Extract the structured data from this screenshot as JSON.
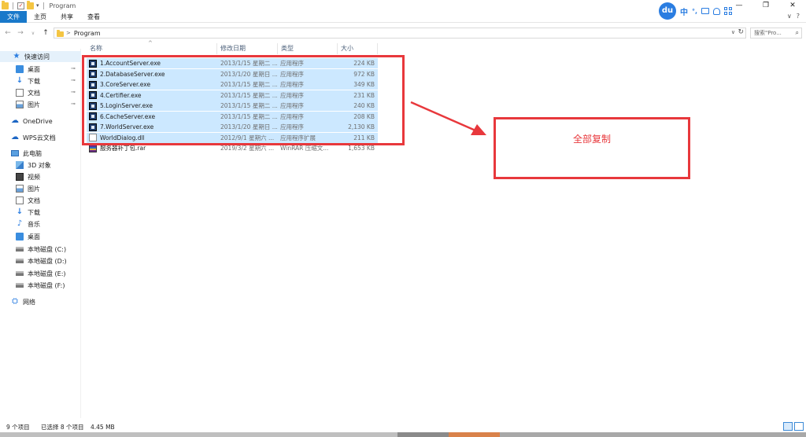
{
  "window": {
    "title": "Program",
    "minimize": "—",
    "restore": "❐",
    "close": "✕"
  },
  "ribbon": {
    "tabs": [
      {
        "label": "文件",
        "active": true
      },
      {
        "label": "主页",
        "active": false
      },
      {
        "label": "共享",
        "active": false
      },
      {
        "label": "查看",
        "active": false
      }
    ],
    "collapse_glyph": "∨",
    "help_glyph": "?"
  },
  "ime": {
    "logo": "du",
    "mode": "中",
    "punct": "°,"
  },
  "address": {
    "path": "Program",
    "back": "←",
    "forward": "→",
    "recent": "∨",
    "up": "↑",
    "crumb_sep": ">",
    "dropdown": "∨",
    "refresh": "↻",
    "search_placeholder": "搜索\"Pro...",
    "search_glyph": "⌕"
  },
  "sidebar": {
    "quick_access": {
      "label": "快速访问",
      "glyph": "★"
    },
    "pinned": [
      {
        "label": "桌面",
        "icon": "desktop-icon"
      },
      {
        "label": "下载",
        "icon": "download-icon",
        "glyph": "↓"
      },
      {
        "label": "文档",
        "icon": "document-icon"
      },
      {
        "label": "图片",
        "icon": "picture-icon"
      }
    ],
    "pin_glyph": "📌",
    "onedrive": {
      "label": "OneDrive",
      "glyph": "☁"
    },
    "wps": {
      "label": "WPS云文档",
      "glyph": "☁"
    },
    "this_pc": {
      "label": "此电脑"
    },
    "pc_items": [
      {
        "label": "3D 对象",
        "icon": "3d-objects-icon"
      },
      {
        "label": "视频",
        "icon": "video-icon"
      },
      {
        "label": "图片",
        "icon": "picture-icon"
      },
      {
        "label": "文档",
        "icon": "document-icon"
      },
      {
        "label": "下载",
        "icon": "download-icon",
        "glyph": "↓"
      },
      {
        "label": "音乐",
        "icon": "music-icon",
        "glyph": "♪"
      },
      {
        "label": "桌面",
        "icon": "desktop-icon"
      },
      {
        "label": "本地磁盘 (C:)",
        "icon": "drive-icon"
      },
      {
        "label": "本地磁盘 (D:)",
        "icon": "drive-icon"
      },
      {
        "label": "本地磁盘 (E:)",
        "icon": "drive-icon"
      },
      {
        "label": "本地磁盘 (F:)",
        "icon": "drive-icon"
      }
    ],
    "network": {
      "label": "网络",
      "glyph": "⛭"
    }
  },
  "columns": {
    "name": "名称",
    "date": "修改日期",
    "type": "类型",
    "size": "大小",
    "sort_glyph": "^"
  },
  "files": [
    {
      "name": "1.AccountServer.exe",
      "date": "2013/1/15 星期二 ...",
      "type": "应用程序",
      "size": "224 KB",
      "kind": "exe",
      "selected": true
    },
    {
      "name": "2.DatabaseServer.exe",
      "date": "2013/1/20 星期日 ...",
      "type": "应用程序",
      "size": "972 KB",
      "kind": "exe",
      "selected": true
    },
    {
      "name": "3.CoreServer.exe",
      "date": "2013/1/15 星期二 ...",
      "type": "应用程序",
      "size": "349 KB",
      "kind": "exe",
      "selected": true
    },
    {
      "name": "4.Certifier.exe",
      "date": "2013/1/15 星期二 ...",
      "type": "应用程序",
      "size": "231 KB",
      "kind": "exe",
      "selected": true
    },
    {
      "name": "5.LoginServer.exe",
      "date": "2013/1/15 星期二 ...",
      "type": "应用程序",
      "size": "240 KB",
      "kind": "exe",
      "selected": true
    },
    {
      "name": "6.CacheServer.exe",
      "date": "2013/1/15 星期二 ...",
      "type": "应用程序",
      "size": "208 KB",
      "kind": "exe",
      "selected": true
    },
    {
      "name": "7.WorldServer.exe",
      "date": "2013/1/20 星期日 ...",
      "type": "应用程序",
      "size": "2,130 KB",
      "kind": "exe",
      "selected": true
    },
    {
      "name": "WorldDialog.dll",
      "date": "2012/9/1 星期六 ...",
      "type": "应用程序扩展",
      "size": "211 KB",
      "kind": "dll",
      "selected": true
    },
    {
      "name": "服务器补丁包.rar",
      "date": "2019/3/2 星期六 ...",
      "type": "WinRAR 压缩文...",
      "size": "1,653 KB",
      "kind": "rar",
      "selected": false
    }
  ],
  "annotation": {
    "text": "全部复制",
    "color": "#e8383c"
  },
  "status": {
    "count": "9 个项目",
    "selected": "已选择 8 个项目",
    "size": "4.45 MB"
  },
  "colors": {
    "accent": "#1979ca",
    "selection": "#cce8ff"
  }
}
